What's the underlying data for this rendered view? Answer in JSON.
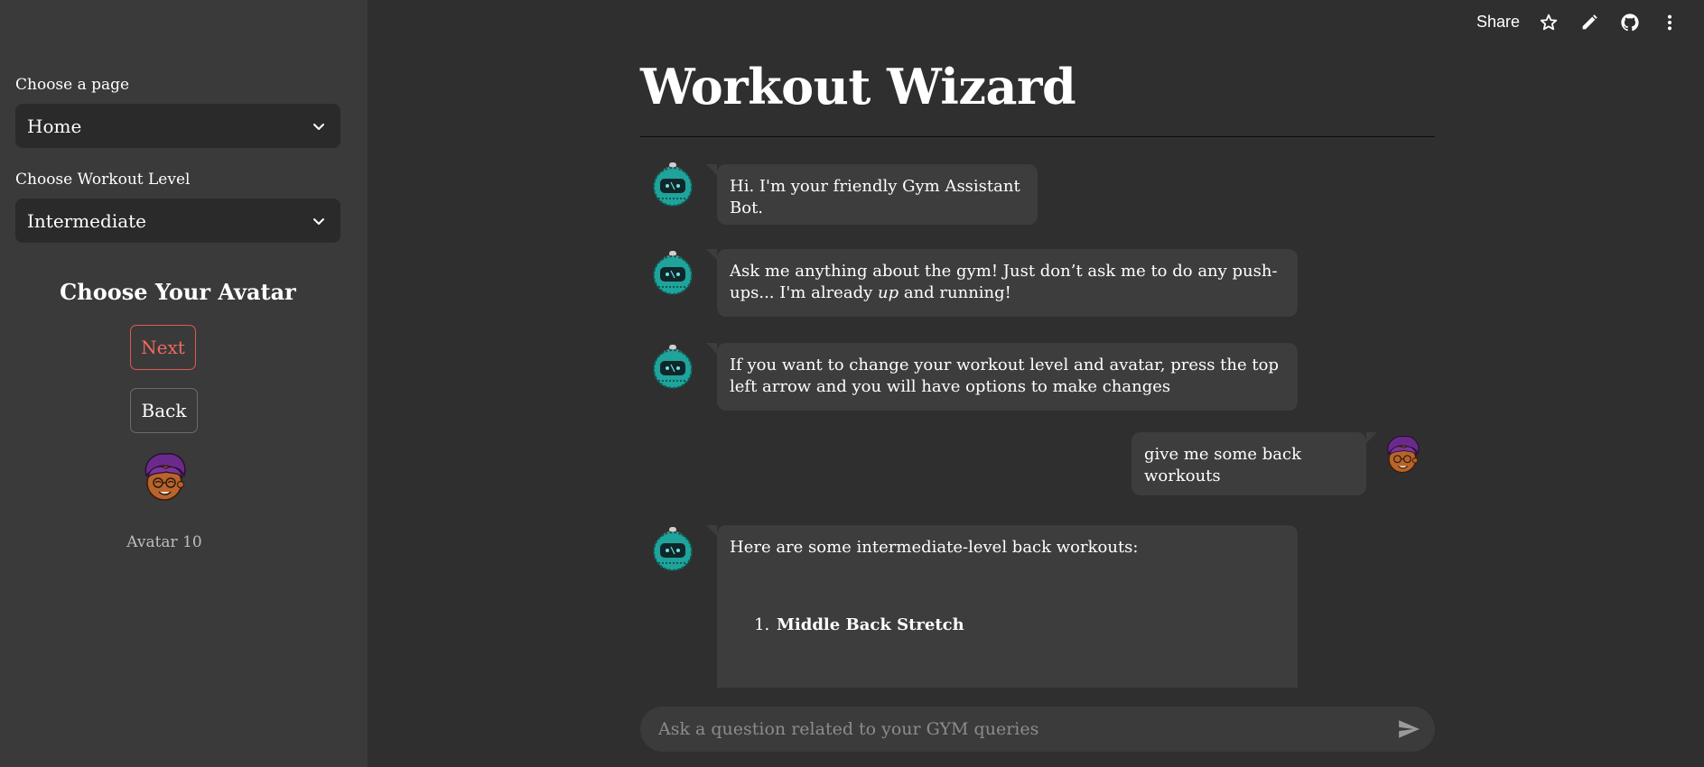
{
  "sidebar": {
    "page_label": "Choose a page",
    "page_selected": "Home",
    "level_label": "Choose Workout Level",
    "level_selected": "Intermediate",
    "avatar_heading": "Choose Your Avatar",
    "next_label": "Next",
    "back_label": "Back",
    "avatar_caption": "Avatar 10"
  },
  "toolbar": {
    "share_label": "Share",
    "icons": [
      "star-icon",
      "pencil-icon",
      "github-icon",
      "more-vertical-icon"
    ]
  },
  "main": {
    "title": "Workout Wizard",
    "messages": [
      {
        "role": "bot",
        "text": "Hi. I'm your friendly Gym Assistant Bot."
      },
      {
        "role": "bot",
        "text_before": "Ask me anything about the gym! Just don’t ask me to do any push-ups... I'm already ",
        "text_em": "up",
        "text_after": " and running!"
      },
      {
        "role": "bot",
        "text": "If you want to change your workout level and avatar, press the top left arrow and you will have options to make changes"
      },
      {
        "role": "user",
        "text": "give me some back workouts"
      },
      {
        "role": "bot",
        "text": "Here are some intermediate-level back workouts:",
        "list": [
          {
            "title": "Middle Back Stretch"
          }
        ]
      }
    ],
    "input_placeholder": "Ask a question related to your GYM queries"
  },
  "colors": {
    "background": "#2f2f2f",
    "sidebar": "#3a3a3a",
    "bubble": "#3d3d3d",
    "accent_next": "#f06a5f",
    "bot_teal": "#1fa39a",
    "avatar_hair": "#6a2a8c"
  }
}
